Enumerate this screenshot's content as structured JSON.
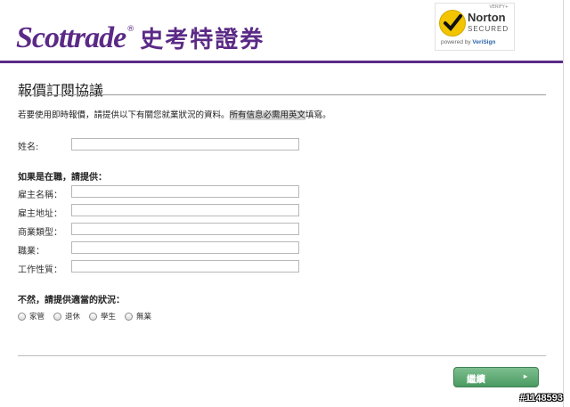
{
  "header": {
    "logo_en": "Scottrade",
    "logo_reg": "®",
    "logo_cn": "史考特證券",
    "norton": {
      "verify": "VERIFY+",
      "name": "Norton",
      "secured": "SECURED",
      "powered_prefix": "powered by ",
      "powered_brand": "VeriSign"
    }
  },
  "page": {
    "title": "報價訂閱協議",
    "intro": "若要使用即時報價，請提供以下有關您就業狀況的資料。",
    "intro_highlight": "所有信息必需用英文",
    "intro_tail": "填寫。"
  },
  "form": {
    "name_label": "姓名:",
    "employed_heading": "如果是在職，請提供：",
    "employed_fields": [
      {
        "label": "雇主名稱："
      },
      {
        "label": "雇主地址："
      },
      {
        "label": "商業類型："
      },
      {
        "label": "職業："
      },
      {
        "label": "工作性質："
      }
    ],
    "status_heading": "不然，請提供適當的狀況：",
    "status_options": [
      "家管",
      "退休",
      "學生",
      "無業"
    ]
  },
  "actions": {
    "continue_label": "繼續",
    "continue_arrow": "▸"
  },
  "watermark": "#1148593",
  "colors": {
    "brand_purple": "#5b2a86",
    "button_green": "#4a9a62",
    "norton_yellow": "#f2c500"
  }
}
